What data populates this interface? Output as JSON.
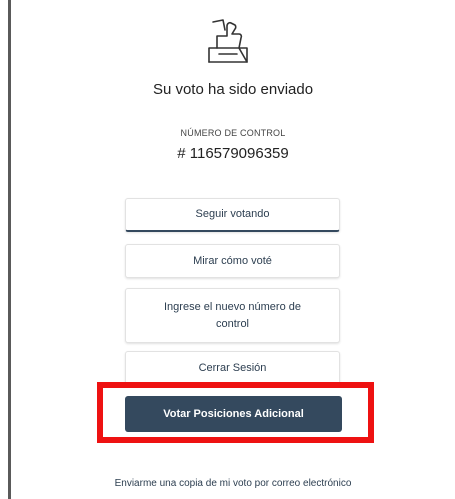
{
  "confirmation": {
    "title": "Su voto ha sido enviado",
    "control_label": "NÚMERO DE CONTROL",
    "control_number": "# 116579096359"
  },
  "buttons": {
    "seguir": "Seguir votando",
    "mirar": "Mirar cómo voté",
    "ingrese": "Ingrese el nuevo número de control",
    "cerrar": "Cerrar Sesión",
    "votar_adicional": "Votar Posiciones Adicional"
  },
  "footer": {
    "email_copy": "Enviarme una copia de mi voto por correo electrónico"
  },
  "icons": {
    "ballot": "ballot-box-icon"
  },
  "colors": {
    "primary": "#34495e",
    "highlight": "#ee1111",
    "text": "#2c3e50"
  }
}
